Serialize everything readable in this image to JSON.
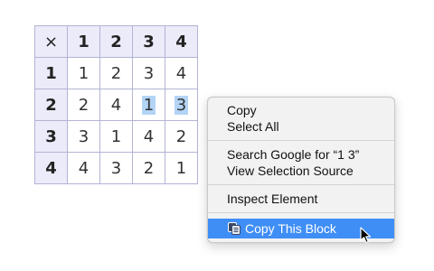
{
  "table": {
    "corner": "×",
    "col_headers": [
      "1",
      "2",
      "3",
      "4"
    ],
    "rows": [
      {
        "header": "1",
        "cells": [
          "1",
          "2",
          "3",
          "4"
        ]
      },
      {
        "header": "2",
        "cells": [
          "2",
          "4",
          "1",
          "3"
        ]
      },
      {
        "header": "3",
        "cells": [
          "3",
          "1",
          "4",
          "2"
        ]
      },
      {
        "header": "4",
        "cells": [
          "4",
          "3",
          "2",
          "1"
        ]
      }
    ],
    "selected_text": "1 3"
  },
  "context_menu": {
    "copy": "Copy",
    "select_all": "Select All",
    "search_google": "Search Google for “1 3”",
    "view_selection_source": "View Selection Source",
    "inspect_element": "Inspect Element",
    "copy_this_block": "Copy This Block",
    "highlight_color": "#3f8ef6",
    "copy_block_icon": "copy-block-icon"
  },
  "colors": {
    "header_bg": "#ebebfa",
    "grid_border": "#b2b4d4",
    "selection_bg": "#b3d4f5"
  }
}
